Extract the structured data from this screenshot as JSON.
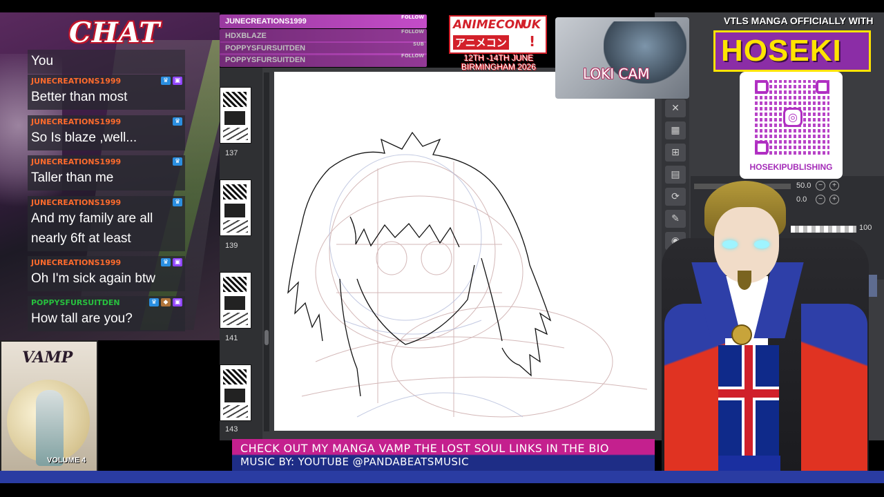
{
  "chat": {
    "title": "CHAT",
    "messages": [
      {
        "user": "You",
        "text": ""
      },
      {
        "user": "JUNECREATIONS1999",
        "text": "Better than most"
      },
      {
        "user": "JUNECREATIONS1999",
        "text": "So Is blaze ,well..."
      },
      {
        "user": "JUNECREATIONS1999",
        "text": "Taller than me"
      },
      {
        "user": "JUNECREATIONS1999",
        "text": "And my family are all nearly 6ft at least"
      },
      {
        "user": "JUNECREATIONS1999",
        "text": "Oh I'm sick again btw"
      },
      {
        "user": "POPPYSFURSUITDEN",
        "text": "How tall are you?"
      }
    ]
  },
  "alerts": [
    {
      "name": "JUNECREATIONS1999",
      "kind": "FOLLOW"
    },
    {
      "name": "HDXBLAZE",
      "kind": "FOLLOW"
    },
    {
      "name": "POPPYSFURSUITDEN",
      "kind": "SUB"
    },
    {
      "name": "POPPYSFURSUITDEN",
      "kind": "FOLLOW"
    }
  ],
  "page_strip": {
    "pages": [
      "137",
      "139",
      "141",
      "143"
    ]
  },
  "animecon": {
    "line1": "ANIMECON",
    "uk": "UK",
    "jp": "アニメコン",
    "bang": "!",
    "dates_1": "12TH -14TH JUNE",
    "dates_2": "BIRMINGHAM 2026"
  },
  "loki_cam": {
    "label": "LOKI CAM"
  },
  "hoseki": {
    "vtls_label": "VTLS MANGA OFFICIALLY WITH",
    "brand": "HOSEKI",
    "handle": "HOSEKIPUBLISHING"
  },
  "tool_panel": {
    "slider1_value": "50.0",
    "slider2_value": "0.0",
    "opacity_value": "100"
  },
  "book": {
    "title": "VAMP",
    "volume": "VOLUME 4"
  },
  "banner": {
    "line1": "CHECK OUT MY MANGA VAMP THE LOST SOUL LINKS IN THE BIO",
    "line2": "MUSIC BY: YOUTUBE @PANDABEATSMUSIC"
  },
  "colors": {
    "chat_user": "#ff6b2c",
    "chat_user_alt": "#27c13e",
    "alert_bg": "#c44cc8",
    "hoseki_yellow": "#ffe400",
    "hoseki_purple": "#8b2da6",
    "banner_pink": "#c4208e",
    "banner_blue": "#1e2d86"
  }
}
